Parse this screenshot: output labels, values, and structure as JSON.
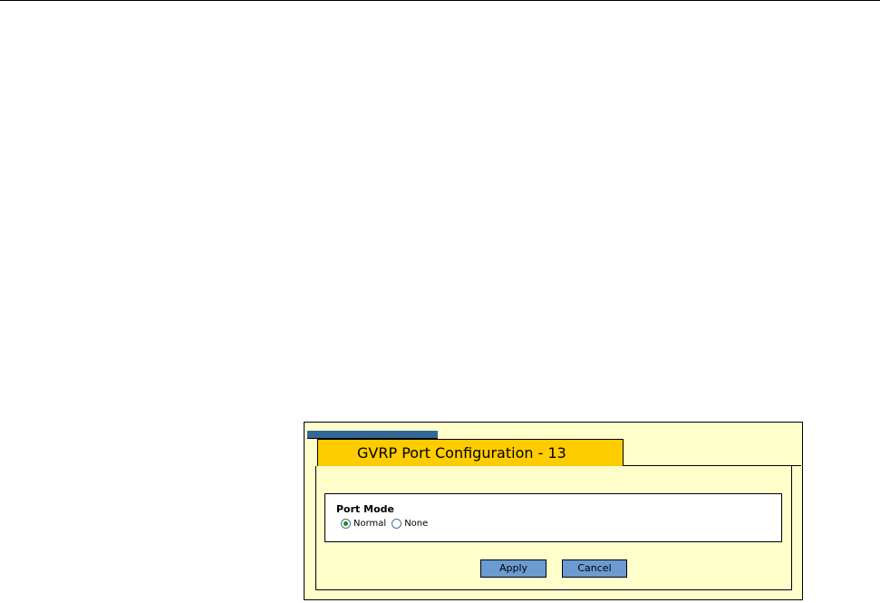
{
  "dialog": {
    "title": "GVRP Port Configuration - 13",
    "port_mode": {
      "label": "Port Mode",
      "options": [
        {
          "label": "Normal",
          "selected": true
        },
        {
          "label": "None",
          "selected": false
        }
      ]
    },
    "buttons": {
      "apply_label": "Apply",
      "cancel_label": "Cancel"
    }
  },
  "colors": {
    "panel_bg": "#ffffcc",
    "title_tab_bg": "#ffcc00",
    "strip": "#336699",
    "button_bg": "#6b9bd1",
    "radio_selected": "#1a8a1a"
  }
}
